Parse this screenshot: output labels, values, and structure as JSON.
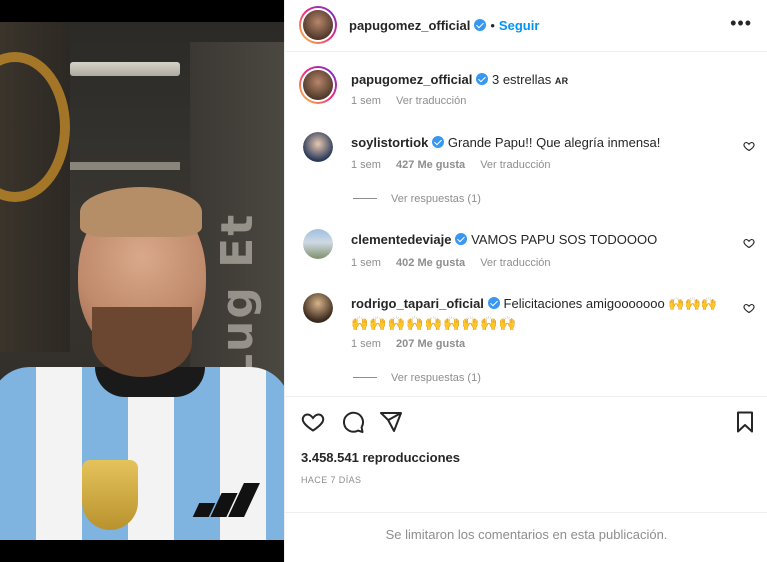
{
  "media": {
    "wall_text": "Lug Et"
  },
  "post": {
    "author": "papugomez_official",
    "dot": "•",
    "follow_label": "Seguir",
    "more_label": "•••",
    "caption": {
      "author": "papugomez_official",
      "text": "3 estrellas",
      "flag": "AR",
      "time": "1 sem",
      "translate": "Ver traducción"
    },
    "comments": [
      {
        "user": "soylistortiok",
        "verified": true,
        "text": "Grande Papu!! Que alegría inmensa!",
        "time": "1 sem",
        "likes": "427 Me gusta",
        "translate": "Ver traducción",
        "replies": "Ver respuestas (1)"
      },
      {
        "user": "clementedeviaje",
        "verified": true,
        "text": "VAMOS PAPU SOS TODOOOO",
        "time": "1 sem",
        "likes": "402 Me gusta",
        "translate": "Ver traducción"
      },
      {
        "user": "rodrigo_tapari_oficial",
        "verified": true,
        "text": "Felicitaciones amigooooooo 🙌🙌🙌",
        "text2": "🙌🙌🙌🙌🙌🙌🙌🙌🙌",
        "time": "1 sem",
        "likes": "207 Me gusta",
        "replies": "Ver respuestas (1)"
      }
    ],
    "actions": {
      "like": "heart-icon",
      "comment": "comment-icon",
      "share": "share-icon",
      "save": "bookmark-icon"
    },
    "views": "3.458.541 reproducciones",
    "date": "HACE 7 DÍAS",
    "comments_limited": "Se limitaron los comentarios en esta publicación."
  },
  "colors": {
    "link": "#0095f6",
    "verified": "#3897f0",
    "muted": "#8e8e8e",
    "text": "#262626"
  }
}
